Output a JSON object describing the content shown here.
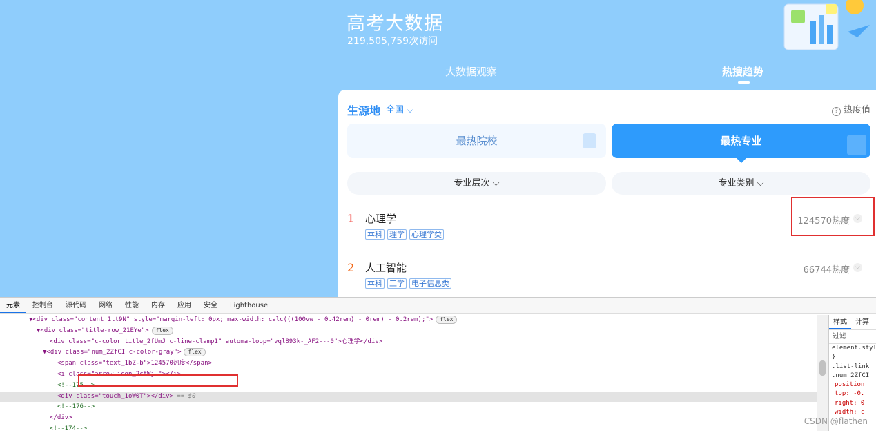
{
  "header": {
    "title": "高考大数据",
    "visits": "219,505,759次访问",
    "tabs": [
      {
        "label": "大数据观察",
        "active": false
      },
      {
        "label": "热搜趋势",
        "active": true
      }
    ]
  },
  "filters": {
    "origin_label": "生源地",
    "origin_value": "全国 ⌵",
    "heat_help": "热度值",
    "segments": [
      "最热院校",
      "最热专业"
    ],
    "active_segment": "最热专业",
    "dropdowns": [
      "专业层次 ⌵",
      "专业类别 ⌵"
    ]
  },
  "ranking": [
    {
      "rank": "1",
      "name": "心理学",
      "tags": [
        "本科",
        "理学",
        "心理学类"
      ],
      "heat": "124570热度"
    },
    {
      "rank": "2",
      "name": "人工智能",
      "tags": [
        "本科",
        "工学",
        "电子信息类"
      ],
      "heat": "66744热度"
    }
  ],
  "devtools": {
    "tabs": [
      "元素",
      "控制台",
      "源代码",
      "网络",
      "性能",
      "内存",
      "应用",
      "安全",
      "Lighthouse"
    ],
    "active_tab": "元素",
    "lines": [
      {
        "text": "▼<div class=\"content_1tt9N\" style=\"margin-left: 0px; max-width: calc(((100vw - 0.42rem) - 0rem) - 0.2rem);\">",
        "pill": "flex"
      },
      {
        "text": "▼<div class=\"title-row_21EYe\">",
        "pill": "flex"
      },
      {
        "text": "<div class=\"c-color title_2fUmJ c-line-clamp1\" automa-loop=\"vql893k-_AF2---0\">心理学</div>",
        "pill": ""
      },
      {
        "text": "▼<div class=\"num_2ZfCI c-color-gray\">",
        "pill": "flex"
      },
      {
        "text": "<span class=\"text_1bZ-b\">124570热度</span>",
        "pill": ""
      },
      {
        "text": "<i class=\"arrow-icon_2ctWj \"></i>",
        "pill": ""
      },
      {
        "text": "<!--175-->",
        "pill": ""
      },
      {
        "text": "<div class=\"touch_1oW0T\"></div>",
        "pill": "",
        "note": "== $0"
      },
      {
        "text": "<!--176-->",
        "pill": ""
      },
      {
        "text": "</div>",
        "pill": ""
      },
      {
        "text": "<!--174-->",
        "pill": ""
      }
    ],
    "side_tabs": [
      "样式",
      "计算"
    ],
    "side_filter": "过滤",
    "side_lines": [
      "element.style {",
      "}",
      ".list-link_",
      ".num_2ZfCI",
      "position",
      "top: -0.",
      "right: 0",
      "width: c"
    ]
  },
  "watermark": "CSDN @flathen",
  "colors": {
    "sky": "#8fcdfc",
    "accent": "#2e9bfc",
    "rank1": "#f0372f",
    "rank2": "#f26a1b"
  }
}
